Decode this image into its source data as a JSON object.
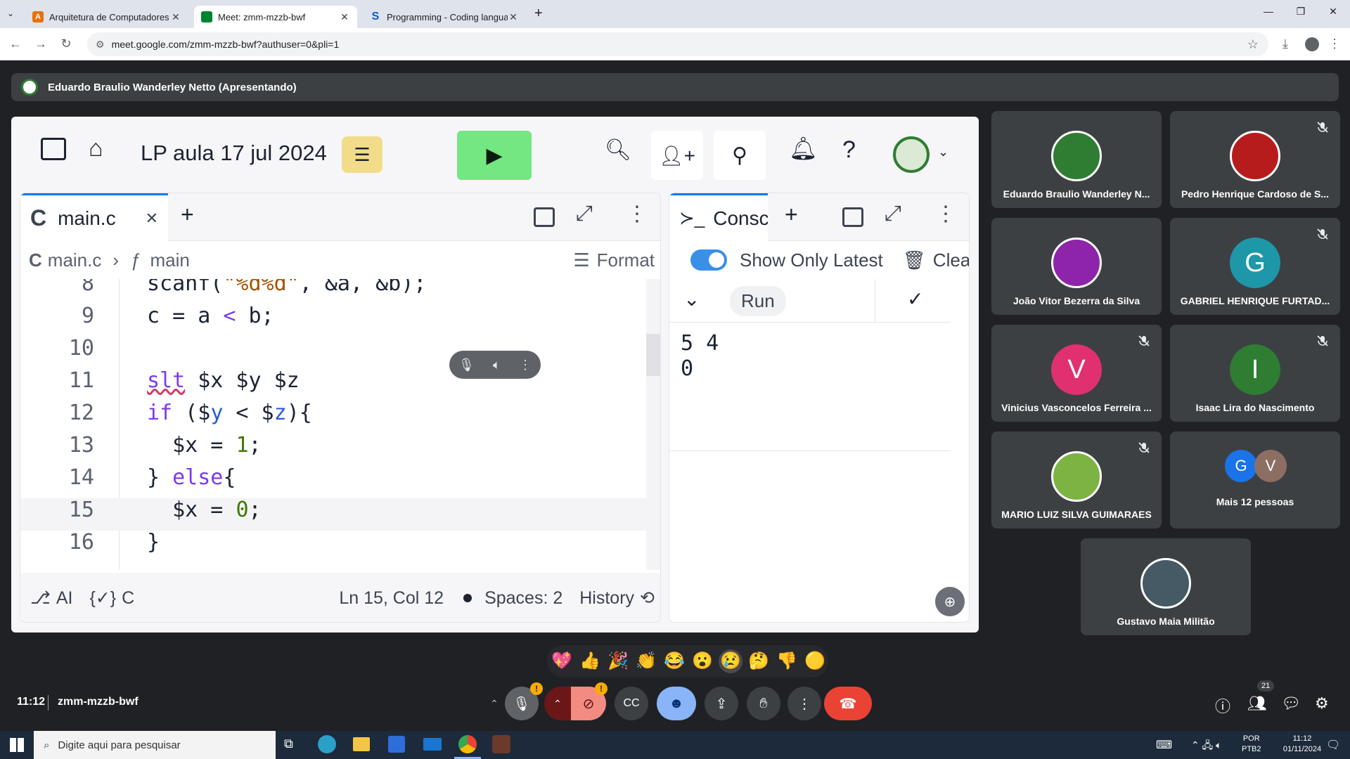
{
  "browser": {
    "tabs": [
      {
        "title": "Arquitetura de Computadores",
        "icon": "document-icon",
        "color": "#e8710a"
      },
      {
        "title": "Meet: zmm-mzzb-bwf",
        "icon": "meet-icon",
        "color": "#00832d",
        "active": true
      },
      {
        "title": "Programming - Coding languag",
        "icon": "s-logo-icon",
        "color": "#0b57d0"
      }
    ],
    "url": "meet.google.com/zmm-mzzb-bwf?authuser=0&pli=1"
  },
  "meet": {
    "presenter": "Eduardo Braulio Wanderley Netto (Apresentando)",
    "time": "11:12",
    "meeting_code": "zmm-mzzb-bwf",
    "participants_count": "21",
    "participants": [
      {
        "name": "Eduardo Braulio Wanderley N...",
        "avatar": "photo",
        "color": "#2e7d32"
      },
      {
        "name": "Pedro Henrique Cardoso de S...",
        "avatar": "photo",
        "color": "#b71c1c",
        "muted": true
      },
      {
        "name": "João Vitor Bezerra da Silva",
        "avatar": "photo",
        "color": "#8e24aa"
      },
      {
        "name": "GABRIEL HENRIQUE FURTAD...",
        "initial": "G",
        "color": "#1e97a8",
        "muted": true
      },
      {
        "name": "Vinicius Vasconcelos Ferreira ...",
        "initial": "V",
        "color": "#e0306f",
        "muted": true
      },
      {
        "name": "Isaac Lira do Nascimento",
        "initial": "I",
        "color": "#2e7d32",
        "muted": true
      },
      {
        "name": "MARIO LUIZ SILVA GUIMARAES",
        "avatar": "photo",
        "color": "#7cb342",
        "muted": true
      },
      {
        "name": "Mais 12 pessoas",
        "initials": [
          "G",
          "V"
        ],
        "colors": [
          "#1a73e8",
          "#8d6e63"
        ]
      },
      {
        "name": "Gustavo Maia Militão",
        "avatar": "photo",
        "color": "#455a64"
      }
    ],
    "reactions": [
      "💖",
      "👍",
      "🎉",
      "👏",
      "😂",
      "😮",
      "😢",
      "🤔",
      "👎",
      "🟡"
    ]
  },
  "replit": {
    "repl_title": "LP aula 17 jul 2024",
    "editor_tab": "main.c",
    "breadcrumb_file": "main.c",
    "breadcrumb_symbol": "main",
    "format_label": "Format",
    "code_lines": [
      {
        "n": "8",
        "text": "scanf(\"%d%d\", &a, &b);"
      },
      {
        "n": "9",
        "text": "c = a < b;"
      },
      {
        "n": "10",
        "text": ""
      },
      {
        "n": "11",
        "text": "slt $x $y $z"
      },
      {
        "n": "12",
        "text": "if ($y < $z){"
      },
      {
        "n": "13",
        "text": "  $x = 1;"
      },
      {
        "n": "14",
        "text": "} else{"
      },
      {
        "n": "15",
        "text": "  $x = 0;"
      },
      {
        "n": "16",
        "text": "}"
      }
    ],
    "status": {
      "ai": "AI",
      "lang": "C",
      "position": "Ln 15, Col 12",
      "spaces": "Spaces: 2",
      "history": "History"
    },
    "console": {
      "tab": "Consc",
      "toggle_label": "Show Only Latest",
      "clear_label": "Clea",
      "run_label": "Run",
      "output": [
        "5 4",
        "0"
      ]
    }
  },
  "taskbar": {
    "search_placeholder": "Digite aqui para pesquisar",
    "lang": "POR",
    "layout": "PTB2",
    "time": "11:12",
    "date": "01/11/2024"
  }
}
